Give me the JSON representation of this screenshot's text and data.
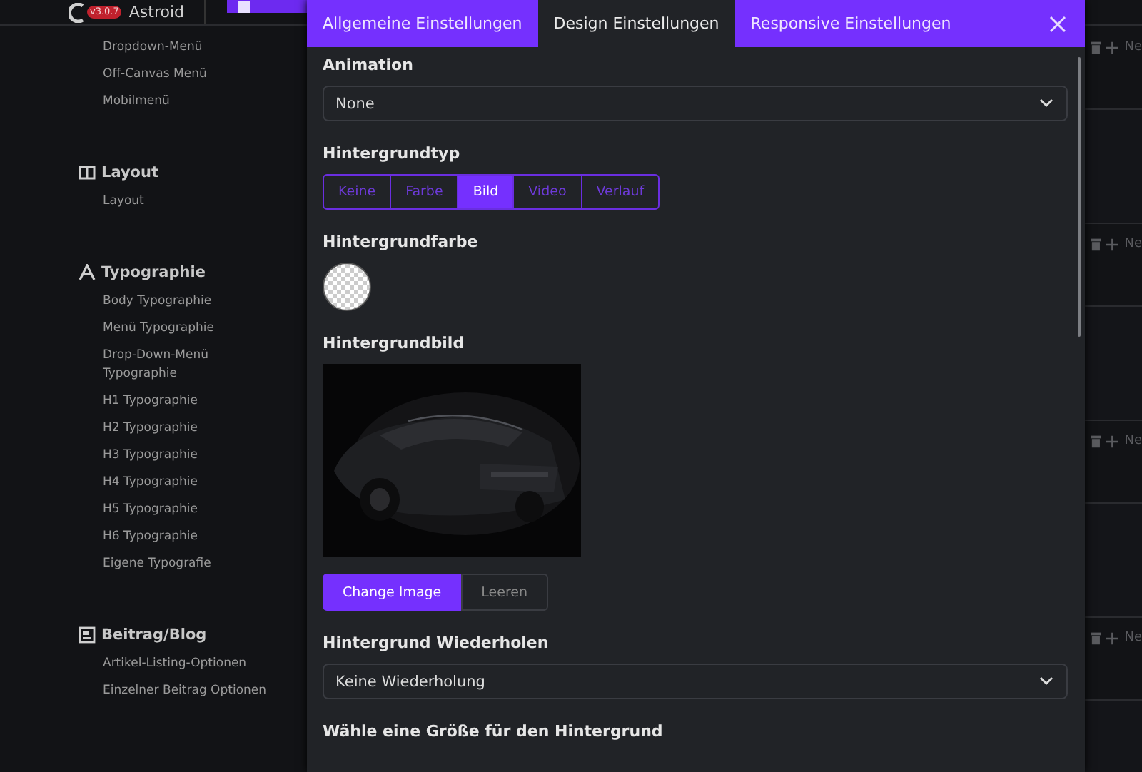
{
  "header": {
    "logo_text": "Astroid",
    "version": "v3.0.7"
  },
  "sidebar": {
    "sections": [
      {
        "items": [
          "Dropdown-Menü",
          "Off-Canvas Menü",
          "Mobilmenü"
        ]
      },
      {
        "kind": "layout",
        "title": "Layout",
        "items": [
          "Layout"
        ]
      },
      {
        "kind": "typography",
        "title": "Typographie",
        "items": [
          "Body Typographie",
          "Menü Typographie",
          "Drop-Down-Menü Typographie",
          "H1 Typographie",
          "H2 Typographie",
          "H3 Typographie",
          "H4 Typographie",
          "H5 Typographie",
          "H6 Typographie",
          "Eigene Typografie"
        ]
      },
      {
        "kind": "blog",
        "title": "Beitrag/Blog",
        "items": [
          "Artikel-Listing-Optionen",
          "Einzelner Beitrag Optionen"
        ]
      }
    ]
  },
  "modal": {
    "tabs": [
      {
        "label": "Allgemeine Einstellungen",
        "selected": false
      },
      {
        "label": "Design Einstellungen",
        "selected": true
      },
      {
        "label": "Responsive Einstellungen",
        "selected": false
      }
    ],
    "fields": [
      {
        "kind": "select",
        "label": "Animation",
        "value": "None"
      },
      {
        "kind": "segmented",
        "label": "Hintergrundtyp",
        "options": [
          {
            "label": "Keine",
            "selected": false
          },
          {
            "label": "Farbe",
            "selected": false
          },
          {
            "label": "Bild",
            "selected": true
          },
          {
            "label": "Video",
            "selected": false
          },
          {
            "label": "Verlauf",
            "selected": false
          }
        ]
      },
      {
        "kind": "color",
        "label": "Hintergrundfarbe"
      },
      {
        "label": "Hintergrundbild",
        "buttons": [
          "Change Image",
          "Leeren"
        ]
      },
      {
        "kind": "select",
        "label": "Hintergrund Wiederholen",
        "value": "Keine Wiederholung"
      },
      {
        "kind": "heading",
        "label": "Wähle eine Größe für den Hintergrund"
      }
    ]
  },
  "right_rows": [
    {
      "action": "Ne"
    },
    {
      "action": "Ne"
    },
    {
      "action": "Ne"
    },
    {
      "action": "Ne"
    }
  ]
}
